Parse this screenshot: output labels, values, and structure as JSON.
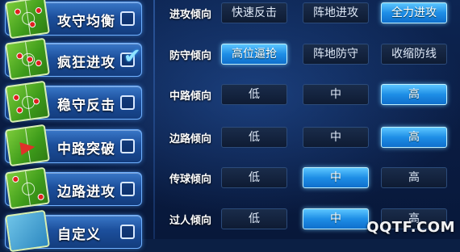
{
  "tactics": [
    {
      "label": "攻守均衡",
      "checked": false
    },
    {
      "label": "疯狂进攻",
      "checked": true
    },
    {
      "label": "稳守反击",
      "checked": false
    },
    {
      "label": "中路突破",
      "checked": false
    },
    {
      "label": "边路进攻",
      "checked": false
    },
    {
      "label": "自定义",
      "checked": false
    }
  ],
  "settings": [
    {
      "label": "进攻倾向",
      "options": [
        "快速反击",
        "阵地进攻",
        "全力进攻"
      ],
      "selected": 2
    },
    {
      "label": "防守倾向",
      "options": [
        "高位逼抢",
        "阵地防守",
        "收缩防线"
      ],
      "selected": 0
    },
    {
      "label": "中路倾向",
      "options": [
        "低",
        "中",
        "高"
      ],
      "selected": 2
    },
    {
      "label": "边路倾向",
      "options": [
        "低",
        "中",
        "高"
      ],
      "selected": 2
    },
    {
      "label": "传球倾向",
      "options": [
        "低",
        "中",
        "高"
      ],
      "selected": 1
    },
    {
      "label": "过人倾向",
      "options": [
        "低",
        "中",
        "高"
      ],
      "selected": 1
    }
  ],
  "checkmark_glyph": "✔",
  "watermark": "QQTF.COM"
}
